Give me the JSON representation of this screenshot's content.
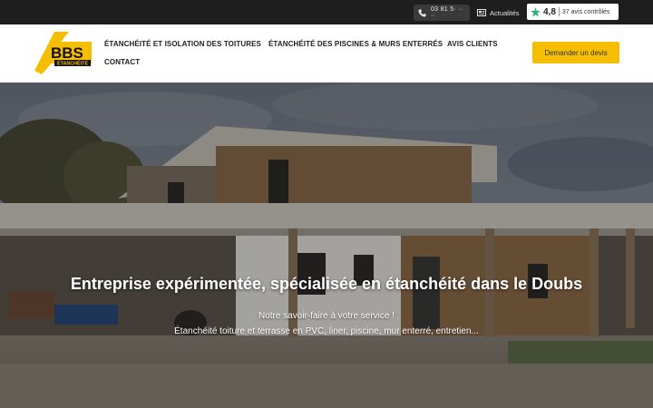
{
  "topbar": {
    "phone": {
      "icon": "phone-icon",
      "number": "03 81 5· ·· ··"
    },
    "news": {
      "icon": "newspaper-icon",
      "label": "Actualités"
    },
    "rating": {
      "icon": "star-logo-icon",
      "score": "4,8",
      "count": "37 avis contrôlés"
    }
  },
  "header": {
    "logo": {
      "main": "BBS",
      "sub": "ÉTANCHÉITÉ"
    },
    "nav": [
      {
        "label": "Étanchéité et isolation des toitures"
      },
      {
        "label": "Étanchéité des piscines & murs enterrés"
      },
      {
        "label": "Avis clients"
      },
      {
        "label": "Contact"
      }
    ],
    "cta": "Demander un devis"
  },
  "hero": {
    "title": "Entreprise expérimentée, spécialisée en étanchéité dans le Doubs",
    "subtitle_line1": "Notre savoir-faire à votre service !",
    "subtitle_line2": "Étanchéité toiture et terrasse en PVC, liner, piscine, mur enterré, entretien..."
  },
  "colors": {
    "accent": "#f6be00",
    "topbar": "#1e1e1e",
    "rating_green": "#2bb673"
  }
}
